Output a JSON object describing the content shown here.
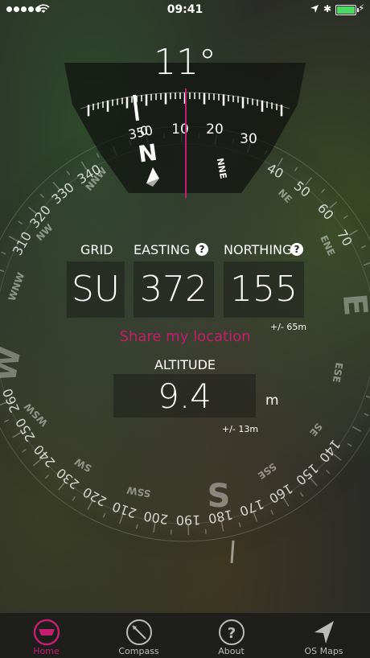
{
  "status_bar": {
    "time": "09:41"
  },
  "compass": {
    "heading": "11°",
    "tape_ticks": [
      "350",
      "0",
      "10",
      "20",
      "30"
    ],
    "north_label": "N",
    "nne_label": "NNE",
    "ring_numbers_left": [
      "340",
      "330",
      "320",
      "310",
      "260",
      "250",
      "240",
      "230",
      "220",
      "210",
      "200",
      "190",
      "180"
    ],
    "ring_numbers_right": [
      "40",
      "50",
      "60",
      "70",
      "140",
      "150",
      "160",
      "170"
    ],
    "cardinal": {
      "E": "E",
      "W": "W",
      "S": "S"
    },
    "intercardinal": {
      "NW": "NW",
      "NE": "NE",
      "SW": "SW",
      "SE": "SE",
      "SSW": "SSW",
      "ESE": "ESE",
      "WSW": "WSW",
      "ENE": "ENE",
      "WNW": "WNW",
      "NNW": "NNW",
      "SSE": "SSE"
    }
  },
  "grid_ref": {
    "grid_label": "GRID",
    "easting_label": "EASTING",
    "northing_label": "NORTHING",
    "help_glyph": "?",
    "grid_value": "SU",
    "easting_value": "372",
    "northing_value": "155",
    "accuracy": "+/- 65m"
  },
  "share_label": "Share my location",
  "altitude": {
    "label": "ALTITUDE",
    "value": "9.4",
    "unit": "m",
    "accuracy": "+/- 13m"
  },
  "tabs": [
    {
      "label": "Home",
      "icon": "home-icon",
      "active": true
    },
    {
      "label": "Compass",
      "icon": "compass-icon",
      "active": false
    },
    {
      "label": "About",
      "icon": "about-icon",
      "active": false
    },
    {
      "label": "OS Maps",
      "icon": "os-maps-icon",
      "active": false
    }
  ],
  "colors": {
    "accent": "#c41f6e",
    "battery": "#4cd964"
  }
}
